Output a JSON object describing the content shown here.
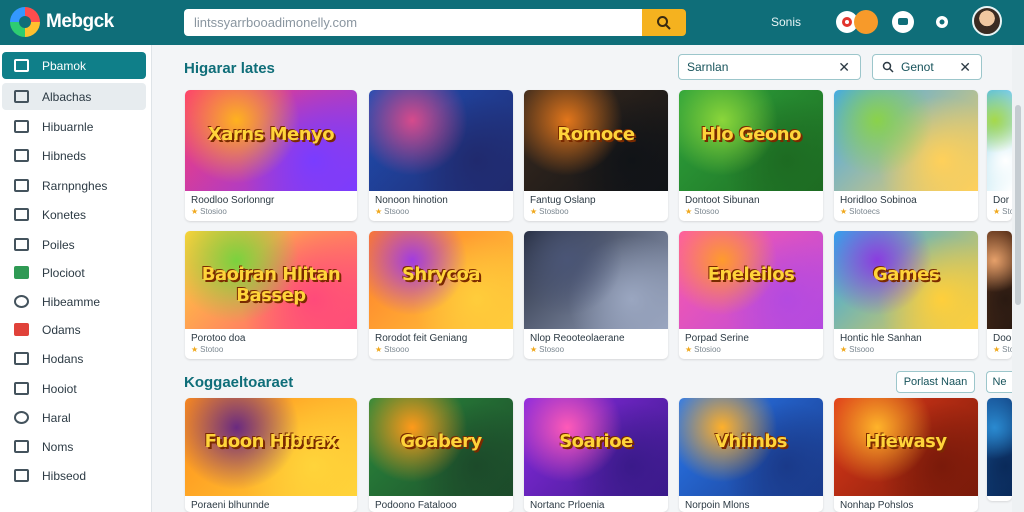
{
  "header": {
    "brand": "Mebgck",
    "search_placeholder": "lintssyarrbooadimonelly.com",
    "link": "Sonis"
  },
  "sidebar": {
    "items": [
      {
        "label": "Pbamok"
      },
      {
        "label": "Albachas"
      },
      {
        "label": "Hibuarnle"
      },
      {
        "label": "Hibneds"
      },
      {
        "label": "Rarnpnghes"
      },
      {
        "label": "Konetes"
      },
      {
        "label": "Poiles"
      },
      {
        "label": "Plocioot"
      },
      {
        "label": "Hibeamme"
      },
      {
        "label": "Odams"
      },
      {
        "label": "Hodans"
      },
      {
        "label": "Hooiot"
      },
      {
        "label": "Haral"
      },
      {
        "label": "Noms"
      },
      {
        "label": "Hibseod"
      }
    ]
  },
  "section1": {
    "title": "Higarar lates",
    "filter1": "Sarnlan",
    "filter2": "Genot"
  },
  "section2": {
    "title": "Koggaeltoaraet",
    "btn1": "Porlast   Naan",
    "btn2": "Ne"
  },
  "rows": [
    [
      {
        "title": "Roodloo Sorlonngr",
        "meta": "Stosioo",
        "art": "Xarns Menyo",
        "colors": [
          "#ff3d6e",
          "#ffb21e",
          "#7a3cff"
        ]
      },
      {
        "title": "Nonoon hinotion",
        "meta": "Stsooo",
        "art": "",
        "colors": [
          "#1f4fb4",
          "#d64b8c",
          "#202a6e"
        ]
      },
      {
        "title": "Fantug Oslanp",
        "meta": "Stosboo",
        "art": "Romoce",
        "colors": [
          "#3a2a1e",
          "#e2761b",
          "#101317"
        ]
      },
      {
        "title": "Dontoot Sibunan",
        "meta": "Stosoo",
        "art": "Hlo Geono",
        "colors": [
          "#2ea43c",
          "#8bd63a",
          "#1d6b22"
        ]
      },
      {
        "title": "Horidloo Sobinoa",
        "meta": "Slotoecs",
        "art": "",
        "colors": [
          "#3ea7f0",
          "#8ad24a",
          "#ffd05a"
        ]
      },
      {
        "title": "Dor",
        "meta": "Sto",
        "art": "",
        "colors": [
          "#5cc0e0",
          "#a6d94a",
          "#fff"
        ]
      }
    ],
    [
      {
        "title": "Porotoo doa",
        "meta": "Stotoo",
        "art": "Baoiran Hlitan Bassep",
        "colors": [
          "#ffd43a",
          "#7ad23e",
          "#ff4a7a"
        ]
      },
      {
        "title": "Rorodot feit Geniang",
        "meta": "Stsooo",
        "art": "Shrycoa",
        "colors": [
          "#ff7a2a",
          "#a13ce0",
          "#ffcd3b"
        ]
      },
      {
        "title": "Nlop Reooteolaerane",
        "meta": "Stosoo",
        "art": "",
        "colors": [
          "#262d40",
          "#4a5576",
          "#9aa6c0"
        ]
      },
      {
        "title": "Porpad Serine",
        "meta": "Stosioo",
        "art": "Eneleilos",
        "colors": [
          "#ff5aa8",
          "#ff9b2c",
          "#b44ae0"
        ]
      },
      {
        "title": "Hontic hle Sanhan",
        "meta": "Stsooo",
        "art": "Games",
        "colors": [
          "#2aa8f0",
          "#8a3ce0",
          "#ffcf3b"
        ]
      },
      {
        "title": "Doo",
        "meta": "Sto",
        "art": "",
        "colors": [
          "#6a3b20",
          "#e6a06a",
          "#2a1a12"
        ]
      }
    ],
    [
      {
        "title": "Poraeni blhunnde",
        "meta": "",
        "art": "Fuoon Hibuax",
        "colors": [
          "#ff8c1a",
          "#6a2a80",
          "#ffd43a"
        ]
      },
      {
        "title": "Podoono Fatalooo",
        "meta": "",
        "art": "Goabery",
        "colors": [
          "#2a8a3c",
          "#ff9a1a",
          "#1c4a2a"
        ]
      },
      {
        "title": "Nortanc Prloenia",
        "meta": "",
        "art": "Soarioe",
        "colors": [
          "#8a2ae0",
          "#ff5ab8",
          "#3a1a8a"
        ]
      },
      {
        "title": "Norpoin Mlons",
        "meta": "",
        "art": "Vhiinbs",
        "colors": [
          "#2a7af0",
          "#ffb02a",
          "#1a3a8a"
        ]
      },
      {
        "title": "Nonhap Pohslos",
        "meta": "",
        "art": "Hiewasy",
        "colors": [
          "#e03a1a",
          "#ffb42a",
          "#7a1a0a"
        ]
      },
      {
        "title": "",
        "meta": "",
        "art": "",
        "colors": [
          "#1a5aa0",
          "#2a8ad0",
          "#0a2a5a"
        ]
      }
    ]
  ]
}
